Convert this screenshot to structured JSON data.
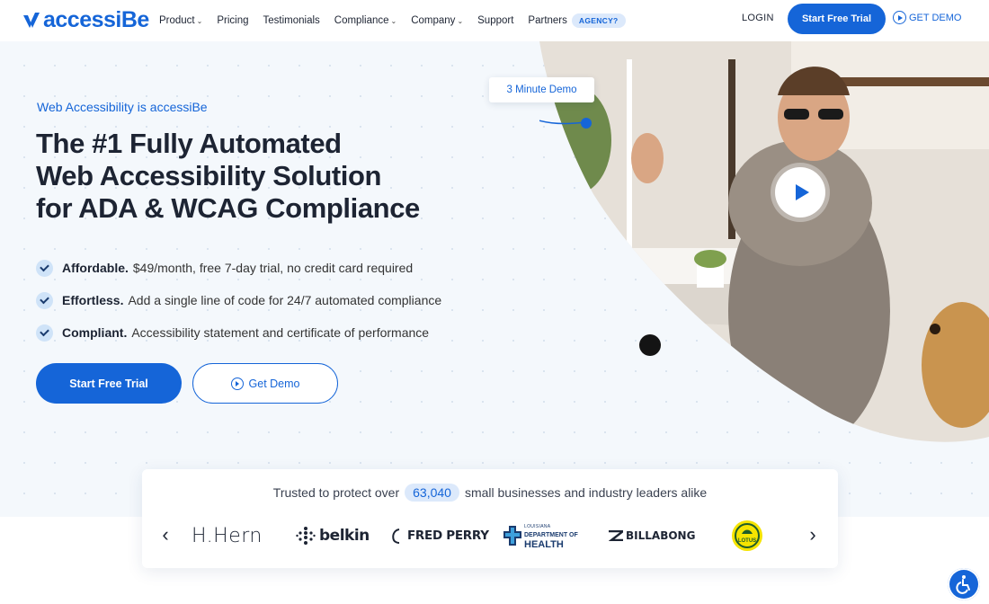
{
  "header": {
    "logo_text": "accessiBe",
    "nav": [
      {
        "label": "Product",
        "dropdown": true
      },
      {
        "label": "Pricing",
        "dropdown": false
      },
      {
        "label": "Testimonials",
        "dropdown": false
      },
      {
        "label": "Compliance",
        "dropdown": true
      },
      {
        "label": "Company",
        "dropdown": true
      },
      {
        "label": "Support",
        "dropdown": false
      },
      {
        "label": "Partners",
        "dropdown": false
      }
    ],
    "agency_badge": "AGENCY?",
    "login": "LOGIN",
    "start_trial": "Start Free Trial",
    "get_demo": "GET DEMO"
  },
  "hero": {
    "eyebrow": "Web Accessibility is accessiBe",
    "headline": [
      "The #1 Fully Automated",
      "Web Accessibility Solution",
      "for ADA & WCAG Compliance"
    ],
    "features": [
      {
        "bold": "Affordable.",
        "text": "$49/month, free 7-day trial, no credit card required"
      },
      {
        "bold": "Effortless.",
        "text": "Add a single line of code for 24/7 automated compliance"
      },
      {
        "bold": "Compliant.",
        "text": "Accessibility statement and certificate of performance"
      }
    ],
    "cta_trial": "Start Free Trial",
    "cta_demo": "Get Demo",
    "demo_tag": "3 Minute Demo"
  },
  "trusted": {
    "prefix": "Trusted to protect over",
    "count": "63,040",
    "suffix": "small businesses and industry leaders alike",
    "brands": {
      "hatern": "H.Hern",
      "belkin": "belkin",
      "fredperry": "FRED PERRY",
      "health_small": "LOUISIANA",
      "health_mid": "DEPARTMENT OF",
      "health_big": "HEALTH",
      "billabong": "BILLABONG",
      "lotus": "LOTUS"
    },
    "prev_arrow": "‹",
    "next_arrow": "›"
  },
  "colors": {
    "brand_blue": "#1565d8",
    "text_dark": "#1d2433",
    "badge_bg": "#dce9fb"
  }
}
